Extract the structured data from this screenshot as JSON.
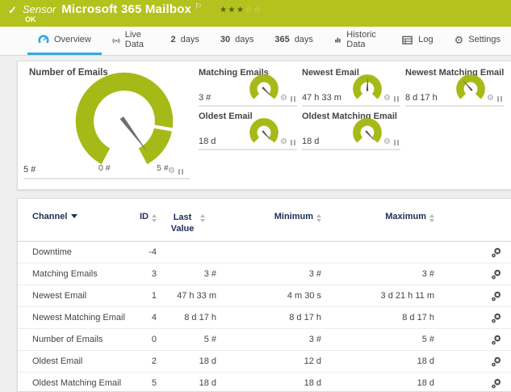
{
  "colors": {
    "brand_green": "#b3c21c",
    "gauge_green": "#a6ba17",
    "accent_blue": "#35a8dd",
    "header_navy": "#1d2f55",
    "text_dark": "#444444",
    "icon_gray": "#5a5a5a",
    "needle_gray": "#6f6f6f"
  },
  "header": {
    "type_label": "Sensor",
    "title": "Microsoft 365 Mailbox",
    "status_text": "OK",
    "rating": {
      "filled": 3,
      "total": 5
    }
  },
  "tabs": [
    {
      "label": "Overview",
      "active": true
    },
    {
      "label": "Live Data"
    },
    {
      "num": "2",
      "label": "days"
    },
    {
      "num": "30",
      "label": "days"
    },
    {
      "num": "365",
      "label": "days"
    },
    {
      "label": "Historic Data"
    },
    {
      "label": "Log"
    },
    {
      "label": "Settings"
    }
  ],
  "gauges": {
    "main": {
      "title": "Number of Emails",
      "value": "5 #",
      "scale_min": "0 #",
      "scale_max": "5 #",
      "needle_deg": 143
    },
    "minis": [
      {
        "title": "Matching Emails",
        "value": "3 #",
        "needle_deg": 135
      },
      {
        "title": "Newest Email",
        "value": "47 h 33 m",
        "needle_deg": 2
      },
      {
        "title": "Newest Matching Email",
        "value": "8 d 17 h",
        "needle_deg": -42
      },
      {
        "title": "Oldest Email",
        "value": "18 d",
        "needle_deg": 138
      },
      {
        "title": "Oldest Matching Email",
        "value": "18 d",
        "needle_deg": 138
      }
    ]
  },
  "table": {
    "columns": {
      "channel": "Channel",
      "id": "ID",
      "last_value": "Last Value",
      "minimum": "Minimum",
      "maximum": "Maximum"
    },
    "rows": [
      {
        "channel": "Downtime",
        "id": "-4",
        "last": "",
        "min": "",
        "max": ""
      },
      {
        "channel": "Matching Emails",
        "id": "3",
        "last": "3 #",
        "min": "3 #",
        "max": "3 #"
      },
      {
        "channel": "Newest Email",
        "id": "1",
        "last": "47 h 33 m",
        "min": "4 m 30 s",
        "max": "3 d 21 h 11 m"
      },
      {
        "channel": "Newest Matching Email",
        "id": "4",
        "last": "8 d 17 h",
        "min": "8 d 17 h",
        "max": "8 d 17 h"
      },
      {
        "channel": "Number of Emails",
        "id": "0",
        "last": "5 #",
        "min": "3 #",
        "max": "5 #"
      },
      {
        "channel": "Oldest Email",
        "id": "2",
        "last": "18 d",
        "min": "12 d",
        "max": "18 d"
      },
      {
        "channel": "Oldest Matching Email",
        "id": "5",
        "last": "18 d",
        "min": "18 d",
        "max": "18 d"
      }
    ]
  }
}
